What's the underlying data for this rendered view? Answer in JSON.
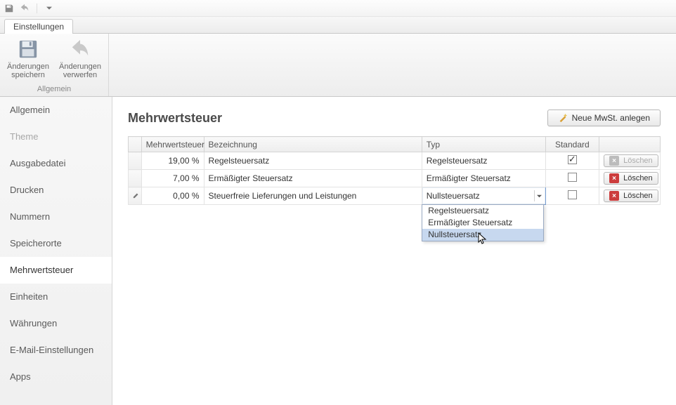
{
  "tab_label": "Einstellungen",
  "ribbon": {
    "save_label": "Änderungen speichern",
    "discard_label": "Änderungen verwerfen",
    "group_label": "Allgemein"
  },
  "sidebar": {
    "items": [
      {
        "label": "Allgemein"
      },
      {
        "label": "Theme"
      },
      {
        "label": "Ausgabedatei"
      },
      {
        "label": "Drucken"
      },
      {
        "label": "Nummern"
      },
      {
        "label": "Speicherorte"
      },
      {
        "label": "Mehrwertsteuer"
      },
      {
        "label": "Einheiten"
      },
      {
        "label": "Währungen"
      },
      {
        "label": "E-Mail-Einstellungen"
      },
      {
        "label": "Apps"
      }
    ],
    "selected_index": 6,
    "muted_index": 1
  },
  "page": {
    "title": "Mehrwertsteuer",
    "new_button": "Neue MwSt. anlegen"
  },
  "grid": {
    "cols": {
      "rate": "Mehrwertsteuer",
      "desc": "Bezeichnung",
      "type": "Typ",
      "standard": "Standard"
    },
    "delete_label": "Löschen",
    "rows": [
      {
        "rate": "19,00 %",
        "desc": "Regelsteuersatz",
        "type": "Regelsteuersatz",
        "standard": true,
        "can_delete": false
      },
      {
        "rate": "7,00 %",
        "desc": "Ermäßigter Steuersatz",
        "type": "Ermäßigter Steuersatz",
        "standard": false,
        "can_delete": true
      },
      {
        "rate": "0,00 %",
        "desc": "Steuerfreie Lieferungen und Leistungen",
        "type": "Nullsteuersatz",
        "standard": false,
        "can_delete": true,
        "editing": true
      }
    ]
  },
  "dropdown": {
    "options": [
      "Regelsteuersatz",
      "Ermäßigter Steuersatz",
      "Nullsteuersatz"
    ],
    "hover_index": 2
  }
}
